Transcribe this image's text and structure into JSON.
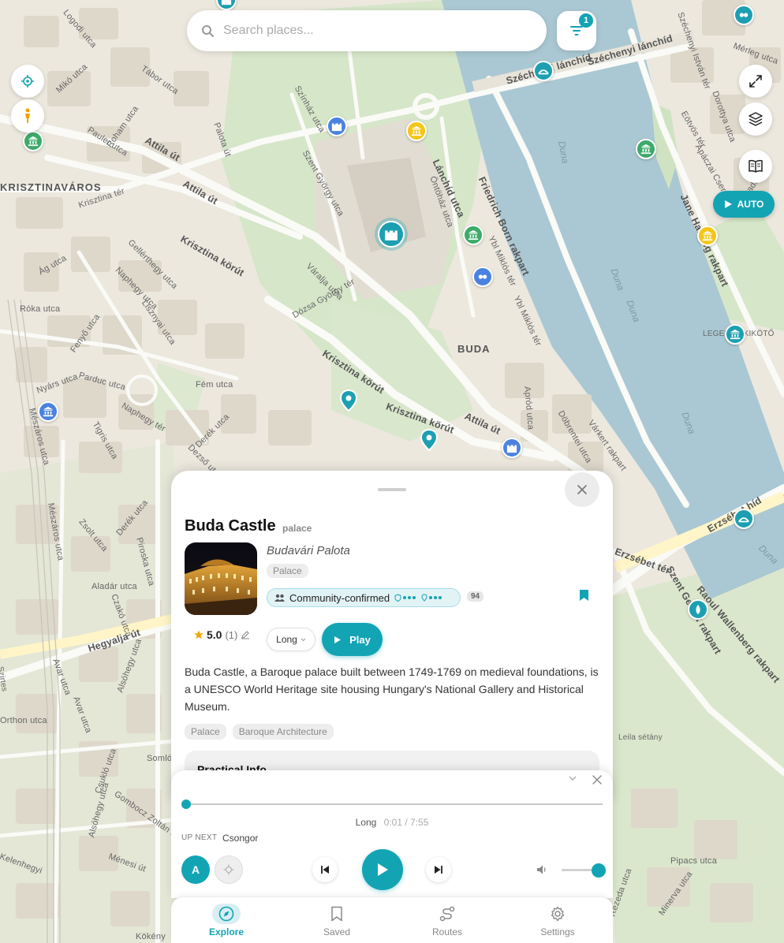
{
  "map": {
    "district_labels": [
      {
        "text": "KRISZTINAVÁROS"
      },
      {
        "text": "BUDA"
      }
    ],
    "street_labels": [
      "Logodi utca",
      "Széchenyi lánchíd",
      "Széchenyi lánchíd",
      "Tábor utca",
      "Mikó utca",
      "Attila út",
      "Attila út",
      "Krisztina tér",
      "Pauler utca",
      "Roham utca",
      "Krisztina körút",
      "Gellérthegy utca",
      "Naphegy utca",
      "Ág utca",
      "Róka utca",
      "Lisznyai utca",
      "Fenyő utca",
      "Parduc utca",
      "Nyárs utca",
      "Mészáros utca",
      "Tigris utca",
      "Derék utca",
      "Dezső utca",
      "Fém utca",
      "Naphegy tér",
      "Váralja utca",
      "Dózsa György tér",
      "Krisztina körút",
      "Krisztina körút",
      "Attila út",
      "Apród utca",
      "Döbrentei utca",
      "Várkert rakpart",
      "Friedrich Born rakpart",
      "Ybl Miklós tér",
      "Ybl Miklós tér",
      "Lánchíd utca",
      "Öntöház utca",
      "Szent György utca",
      "Színház utca",
      "Palota út",
      "Jane Haining rakpart",
      "Széchenyi István tér",
      "Dorottya utca",
      "Eötvös tér",
      "Apáczai Csere",
      "Vigadó tér",
      "Mérleg utca",
      "LEGENDA KIKÖTŐ",
      "Erzsébet híd",
      "Szent Gellért rakpart",
      "Raoul Wallenberg rakpart",
      "Erzsébet tér",
      "Hegyalja út",
      "Zsolt utca",
      "Derék utca",
      "Aladár utca",
      "Czakó utca",
      "Piroska utca",
      "Alsóhegy utca",
      "Avar utca",
      "Avar utca",
      "Somlói",
      "Csukló utca",
      "Gombocz Zoltán utca",
      "Alsóhegy utca",
      "Ménesi út",
      "Orthon utca",
      "Kelenhegyi",
      "Pipacs utca",
      "Minerva utca",
      "Rezeda utca",
      "Kökény",
      "Leila sétány",
      "Hegyalja út",
      "Szirtes",
      "Mészáros utca"
    ],
    "water_labels": [
      "Duna",
      "Duna",
      "Duna",
      "Duna",
      "Duna"
    ]
  },
  "search": {
    "placeholder": "Search places..."
  },
  "filter": {
    "badge": "1"
  },
  "controls": {
    "auto_label": "AUTO"
  },
  "sheet": {
    "title": "Buda Castle",
    "type": "palace",
    "native_name": "Budavári Palota",
    "category": "Palace",
    "confirm_label": "Community-confirmed",
    "confirm_count": "94",
    "rating_value": "5.0",
    "rating_count": "(1)",
    "length_option": "Long",
    "play_label": "Play",
    "description": "Buda Castle, a Baroque palace built between 1749-1769 on medieval foundations, is a UNESCO World Heritage site housing Hungary's National Gallery and Historical Museum.",
    "tags": [
      "Palace",
      "Baroque Architecture"
    ],
    "practical_title": "Practical Info"
  },
  "player": {
    "mode": "Long",
    "elapsed": "0:01",
    "total": "7:55",
    "time_text": "0:01 / 7:55",
    "progress": 0.002,
    "upnext_label": "UP NEXT",
    "upnext_name": "Csongor",
    "avatar_letter": "A",
    "volume": 1.0
  },
  "nav": {
    "items": [
      {
        "label": "Explore",
        "icon": "compass-icon",
        "active": true
      },
      {
        "label": "Saved",
        "icon": "bookmark-icon",
        "active": false
      },
      {
        "label": "Routes",
        "icon": "route-icon",
        "active": false
      },
      {
        "label": "Settings",
        "icon": "gear-icon",
        "active": false
      }
    ]
  },
  "colors": {
    "accent": "#13a4b4",
    "water": "#aac8d3",
    "map_bg": "#ece8de",
    "park": "#cfe3c2"
  }
}
